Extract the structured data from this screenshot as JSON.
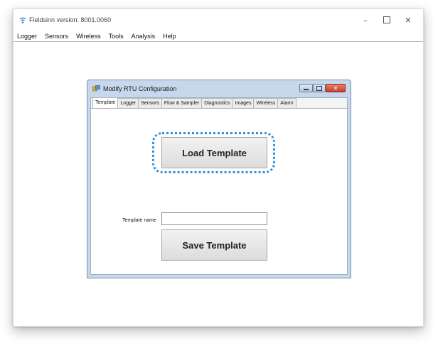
{
  "app": {
    "title": "Fieldsinn version: 8001.0060",
    "minimize_glyph": "–",
    "close_glyph": "✕"
  },
  "menubar": {
    "items": [
      "Logger",
      "Sensors",
      "Wireless",
      "Tools",
      "Analysis",
      "Help"
    ]
  },
  "dialog": {
    "title": "Modify RTU Configuration",
    "close_glyph": "✕",
    "tabs": [
      "Template",
      "Logger",
      "Sensors",
      "Flow & Sampler",
      "Diagnostics",
      "Images",
      "Wireless",
      "Alarm"
    ],
    "active_tab": "Template",
    "load_button_label": "Load Template",
    "template_name_label": "Template name",
    "template_name_value": "",
    "save_button_label": "Save Template"
  },
  "colors": {
    "highlight_dotted": "#2a92e4",
    "dialog_frame": "#c8d8ec",
    "close_button": "#c7402a"
  }
}
